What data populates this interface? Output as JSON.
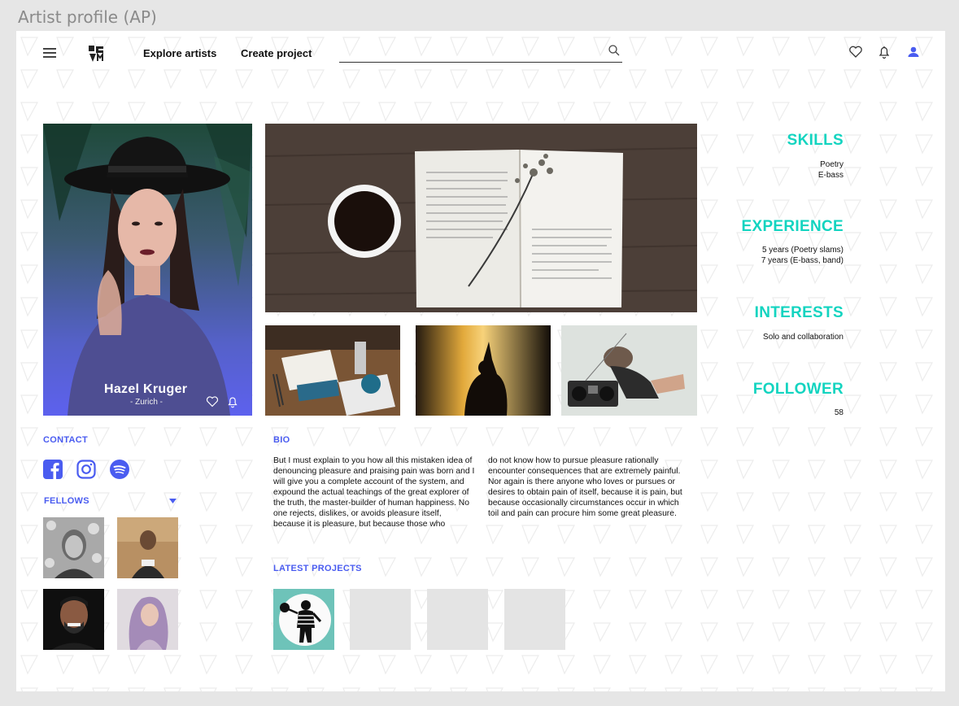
{
  "frame": {
    "title": "Artist profile (AP)"
  },
  "header": {
    "nav": [
      "Explore artists",
      "Create project"
    ],
    "search": {
      "placeholder": "",
      "icon": "search-icon"
    },
    "icons": [
      "heart-icon",
      "bell-icon",
      "user-icon"
    ]
  },
  "profile": {
    "name": "Hazel Kruger",
    "location": "- Zurich -"
  },
  "sidebar": {
    "skills": {
      "title": "SKILLS",
      "items": [
        "Poetry",
        "E-bass"
      ]
    },
    "experience": {
      "title": "EXPERIENCE",
      "items": [
        "5 years (Poetry slams)",
        "7 years (E-bass, band)"
      ]
    },
    "interests": {
      "title": "INTERESTS",
      "items": [
        "Solo and collaboration"
      ]
    },
    "follower": {
      "title": "FOLLOWER",
      "count": "58"
    }
  },
  "contact": {
    "title": "CONTACT",
    "icons": [
      "facebook-icon",
      "instagram-icon",
      "spotify-icon"
    ]
  },
  "fellows": {
    "title": "FELLOWS"
  },
  "bio": {
    "title": "BIO",
    "col1": "But I must explain to you how all this mistaken idea of denouncing pleasure and praising pain was born and I will give you a complete account of the system, and expound the actual teachings of the great explorer of the truth, the master-builder of human happiness. No one rejects, dislikes, or avoids pleasure itself, because it is pleasure, but because those who",
    "col2": "do not know how to pursue pleasure rationally encounter consequences that are extremely painful. Nor again is there anyone who loves or pursues or desires to obtain pain of itself, because it is pain, but because occasionally circumstances occur in which toil and pain can procure him some great pleasure."
  },
  "projects": {
    "title": "LATEST PROJECTS"
  },
  "colors": {
    "accent": "#4a5cf0",
    "teal": "#13d4c0"
  }
}
